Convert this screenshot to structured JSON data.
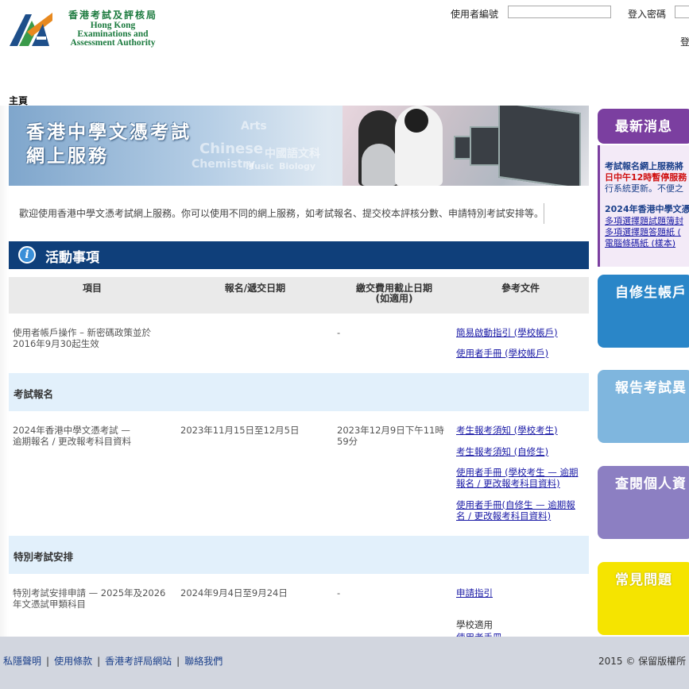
{
  "header": {
    "logo_zh": "香港考試及評核局",
    "logo_en_1": "Hong Kong",
    "logo_en_2": "Examinations and",
    "logo_en_3": "Assessment Authority",
    "username_label": "使用者編號",
    "password_label": "登入密碼",
    "login_button_partial": "登"
  },
  "breadcrumb": "主頁",
  "banner": {
    "title_line1": "香港中學文憑考試",
    "title_line2": "網上服務",
    "bg_words": [
      "Arts",
      "Chinese",
      "Chemistry",
      "中國語文科",
      "Music",
      "Biology"
    ]
  },
  "welcome": "歡迎使用香港中學文憑考試網上服務。你可以使用不同的網上服務，如考試報名、提交校本評核分數、申請特別考試安排等。",
  "activities": {
    "title": "活動事項",
    "columns": [
      "項目",
      "報名/遞交日期",
      "繳交費用截止日期",
      "(如適用)",
      "參考文件"
    ],
    "row1": {
      "item_l1": "使用者帳戶操作 – 新密碼政策並於",
      "item_l2": "2016年9月30起生效",
      "fee": "-",
      "doc1": "簡易啟動指引 (學校帳戶)",
      "doc2": "使用者手冊 (學校帳戶)"
    },
    "section1": "考試報名",
    "row2": {
      "item_l1": "2024年香港中學文憑考試 —",
      "item_l2": "逾期報名 / 更改報考科目資料",
      "date": "2023年11月15日至12月5日",
      "fee_l1": "2023年12月9日下午11時",
      "fee_l2": "59分",
      "doc1": "考生報考須知 (學校考生)",
      "doc2": "考生報考須知 (自修生)",
      "doc3_l1": "使用者手冊 (學校考生 — 逾期",
      "doc3_l2": "報名 / 更改報考科目資料)",
      "doc4_l1": "使用者手冊(自修生 — 逾期報",
      "doc4_l2": "名 / 更改報考科目資料)"
    },
    "section2": "特別考試安排",
    "row3": {
      "item_l1": "特別考試安排申請 — 2025年及2026",
      "item_l2": "年文憑試甲類科目",
      "date": "2024年9月4日至9月24日",
      "fee": "-",
      "doc1": "申請指引",
      "doc2_l1": "學校適用",
      "doc2_l2": "使用者手冊"
    }
  },
  "sidebar": {
    "news_title": "最新消息",
    "news_lines": [
      "考試報名網上服務將",
      "日中午12時暫停服務",
      "行系統更新。不便之",
      "2024年香港中學文憑",
      "多項選擇題試題簿封",
      "多項選擇題答題紙 (",
      "電腦條碼紙 (樣本)"
    ],
    "box2": "自修生帳戶",
    "box3": "報告考試異",
    "box4": "查閱個人資",
    "box5": "常見問題"
  },
  "footer": {
    "links": [
      "私隱聲明",
      "使用條款",
      "香港考評局網站",
      "聯絡我們"
    ],
    "copyright": "2015 © 保留版權所"
  },
  "colors": {
    "nav_blue": "#0f3f7a",
    "news_purple": "#7b3fa0",
    "box_blue": "#2a86c8",
    "box_lightblue": "#7fb6de",
    "box_violet": "#8c7fc2",
    "box_yellow": "#f5e400",
    "footer_bg": "#d2d6df",
    "section_band": "#e2f0fb"
  }
}
